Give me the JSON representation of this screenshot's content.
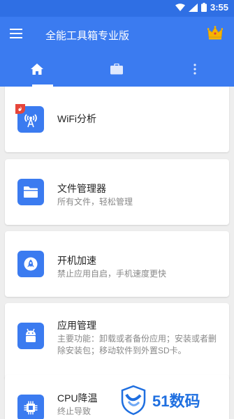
{
  "status_bar": {
    "time": "3:55"
  },
  "app_bar": {
    "title": "全能工具箱专业版"
  },
  "tabs": [
    {
      "name": "home",
      "icon": "home-icon",
      "active": true
    },
    {
      "name": "tools",
      "icon": "briefcase-icon",
      "active": false
    },
    {
      "name": "more",
      "icon": "more-vertical-icon",
      "active": false
    }
  ],
  "cards": [
    {
      "title": "WiFi分析",
      "desc": "",
      "icon": "wifi-tower-icon"
    },
    {
      "title": "文件管理器",
      "desc": "所有文件，轻松管理",
      "icon": "folder-icon"
    },
    {
      "title": "开机加速",
      "desc": "禁止应用自启，手机速度更快",
      "icon": "rocket-icon"
    },
    {
      "title": "应用管理",
      "desc": "主要功能：卸载或者备份应用；安装或者删除安装包；移动软件到外置SD卡。",
      "icon": "android-icon"
    },
    {
      "title": "CPU降温",
      "desc": "终止导致",
      "icon": "cpu-icon"
    }
  ],
  "watermark": {
    "text": "51数码"
  },
  "colors": {
    "primary": "#3b7bf0",
    "status_bar": "#2f6fe4",
    "background": "#eeeeee",
    "crown": "#f5b400"
  }
}
